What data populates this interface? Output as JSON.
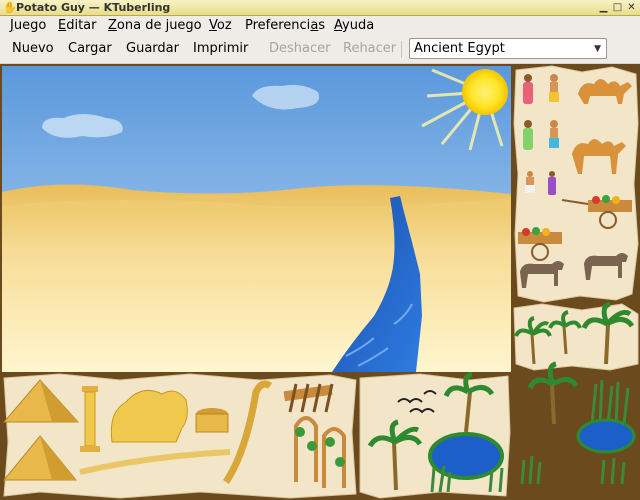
{
  "window": {
    "title": "Potato Guy — KTuberling",
    "app_icon": "potato-icon"
  },
  "menubar": {
    "items": [
      {
        "label_pre": "",
        "mnemonic": "J",
        "label_post": "uego"
      },
      {
        "label_pre": "",
        "mnemonic": "E",
        "label_post": "ditar"
      },
      {
        "label_pre": "",
        "mnemonic": "Z",
        "label_post": "ona de juego"
      },
      {
        "label_pre": "",
        "mnemonic": "V",
        "label_post": "oz"
      },
      {
        "label_pre": "Preferenci",
        "mnemonic": "a",
        "label_post": "s"
      },
      {
        "label_pre": "",
        "mnemonic": "A",
        "label_post": "yuda"
      }
    ]
  },
  "toolbar": {
    "new": "Nuevo",
    "load": "Cargar",
    "save": "Guardar",
    "print": "Imprimir",
    "undo": "Deshacer",
    "redo": "Rehacer",
    "undo_enabled": false,
    "redo_enabled": false
  },
  "scene_selector": {
    "value": "Ancient Egypt"
  },
  "colors": {
    "sky": "#6fa9e6",
    "sand": "#f2d27a",
    "river": "#1d5fc8",
    "frame": "#6b4a1e",
    "parchment": "#f3e6c8",
    "sun": "#ffe628"
  },
  "icons": {
    "titlebar": [
      "potato-icon",
      "minimize-icon",
      "maximize-icon",
      "close-icon"
    ],
    "scene": [
      "sun-icon",
      "cloud-icon",
      "nile-river-icon"
    ],
    "stickers_right": [
      "egyptian-woman-icon",
      "egyptian-man-icon",
      "camel-icon",
      "fruit-cart-icon",
      "donkey-icon",
      "palm-tree-icon"
    ],
    "stickers_bottom": [
      "pyramid-icon",
      "column-icon",
      "sphinx-icon",
      "well-icon",
      "stick-icon",
      "wooden-fence-icon",
      "vine-arch-icon",
      "birds-icon",
      "palm-tree-icon",
      "oasis-pond-icon",
      "reeds-icon"
    ]
  }
}
